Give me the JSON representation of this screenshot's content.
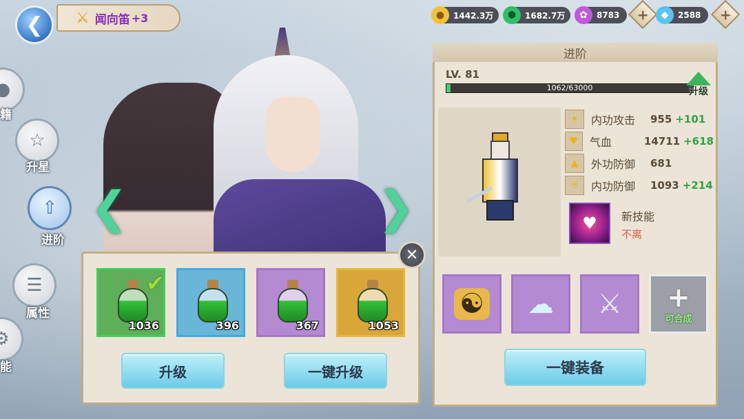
{
  "header": {
    "back_icon": "back-arrow-icon",
    "item_icon": "sword-icon",
    "item_name": "闻向笛",
    "item_level": "+3"
  },
  "currency": [
    {
      "icon": "gold-coin-icon",
      "value": "1442.3万",
      "color": "#f0c23a"
    },
    {
      "icon": "jade-icon",
      "value": "1682.7万",
      "color": "#2fbf6a"
    },
    {
      "icon": "purple-orb-icon",
      "value": "8783",
      "color": "#c05ad8"
    },
    {
      "icon": "diamond-icon",
      "value": "2588",
      "color": "#5ac3ee"
    }
  ],
  "nav": [
    {
      "id": "book",
      "label": "籍",
      "icon": "book-icon"
    },
    {
      "id": "star",
      "label": "升星",
      "icon": "stars-icon"
    },
    {
      "id": "advance",
      "label": "进阶",
      "icon": "advance-icon"
    },
    {
      "id": "attr",
      "label": "属性",
      "icon": "attributes-icon"
    },
    {
      "id": "skill",
      "label": "能",
      "icon": "gear-icon"
    }
  ],
  "potions": [
    {
      "count": "1036",
      "border": "#3fcf5a",
      "bg": "#5fae5a",
      "selected": true
    },
    {
      "count": "396",
      "border": "#3fa9e0",
      "bg": "#6ab6d8",
      "selected": false
    },
    {
      "count": "367",
      "border": "#a676c8",
      "bg": "#b48ad2",
      "selected": false
    },
    {
      "count": "1053",
      "border": "#e6b63a",
      "bg": "#d9a63a",
      "selected": false
    }
  ],
  "left_buttons": {
    "upgrade": "升级",
    "one_key_upgrade": "一键升级"
  },
  "right_panel": {
    "title": "进阶",
    "level": "LV. 81",
    "xp_text": "1062/63000",
    "xp_ratio": 0.017,
    "levelup_label": "升级",
    "stats": [
      {
        "icon": "attack-icon",
        "name": "内功攻击",
        "value": "955",
        "bonus": "+101"
      },
      {
        "icon": "heart-icon",
        "name": "气血",
        "value": "14711",
        "bonus": "+618"
      },
      {
        "icon": "armor-icon",
        "name": "外功防御",
        "value": "681",
        "bonus": ""
      },
      {
        "icon": "shield-icon",
        "name": "内功防御",
        "value": "1093",
        "bonus": "+214"
      }
    ],
    "new_skill_label": "新技能",
    "new_skill_name": "不离",
    "equip": [
      {
        "icon": "taiji-icon"
      },
      {
        "icon": "cloud-icon"
      },
      {
        "icon": "sword-icon"
      },
      {
        "icon": "plus-icon",
        "label": "可合成"
      }
    ],
    "one_key_equip": "一键装备"
  }
}
